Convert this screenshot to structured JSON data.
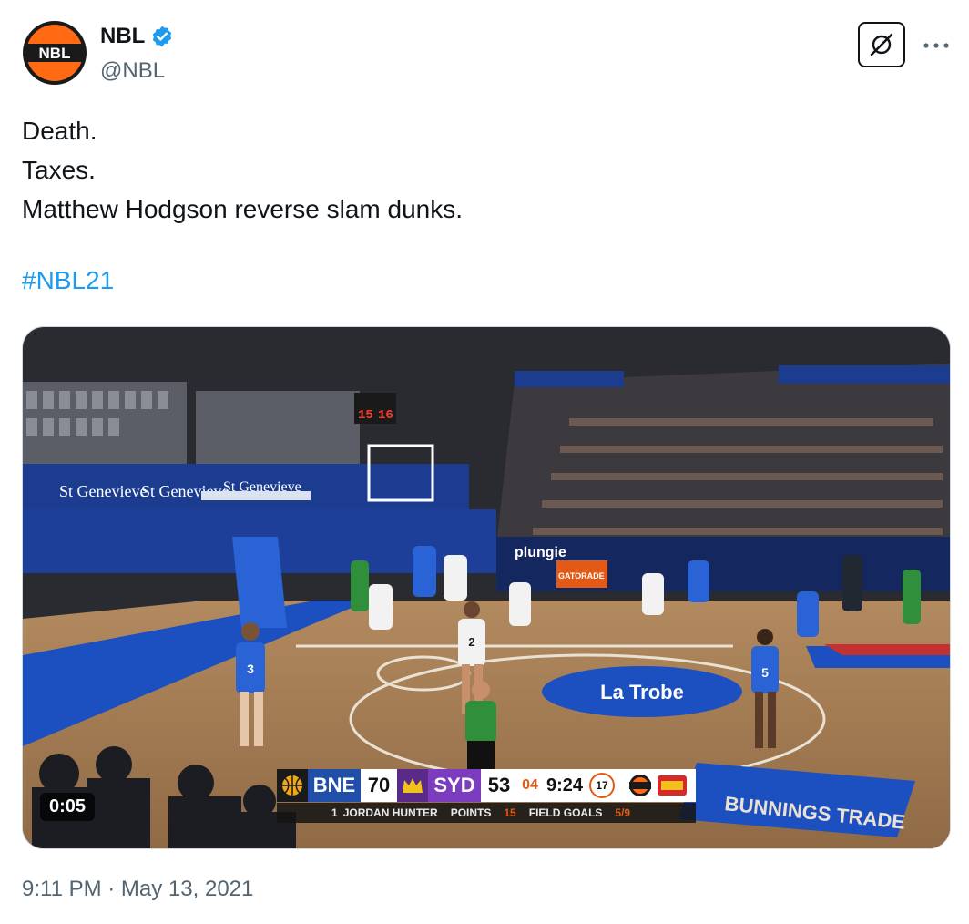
{
  "author": {
    "display_name": "NBL",
    "handle": "@NBL",
    "avatar_icon": "nbl-logo",
    "avatar_text": "NBL",
    "verified_icon": "verified-badge-icon",
    "verified_color": "#1d9bf0"
  },
  "header": {
    "grok_icon": "grok-icon",
    "more_icon": "more-icon"
  },
  "tweet": {
    "lines": [
      "Death.",
      "Taxes.",
      "Matthew Hodgson reverse slam dunks."
    ],
    "hashtag": "#NBL21",
    "hashtag_color": "#1d9bf0"
  },
  "media": {
    "type": "video",
    "duration": "0:05",
    "scoreboard": {
      "home_team": "BNE",
      "home_score": "70",
      "away_team": "SYD",
      "away_score": "53",
      "quarter": "04",
      "clock": "9:24",
      "shot_clock": "17",
      "player_number": "1",
      "player_name": "JORDAN HUNTER",
      "stat1_label": "POINTS",
      "stat1_value": "15",
      "stat2_label": "FIELD GOALS",
      "stat2_value": "5/9"
    },
    "court_text": {
      "sponsor1": "St Genevieve",
      "sponsor2": "La Trobe",
      "sponsor3": "BUNNINGS TRADE",
      "sponsor4": "plungie",
      "sponsor5": "GATORADE",
      "shot_clock_left": "15",
      "shot_clock_right": "16",
      "player3": "3",
      "player2": "2",
      "player5": "5"
    }
  },
  "timestamp": "9:11 PM · May 13, 2021"
}
